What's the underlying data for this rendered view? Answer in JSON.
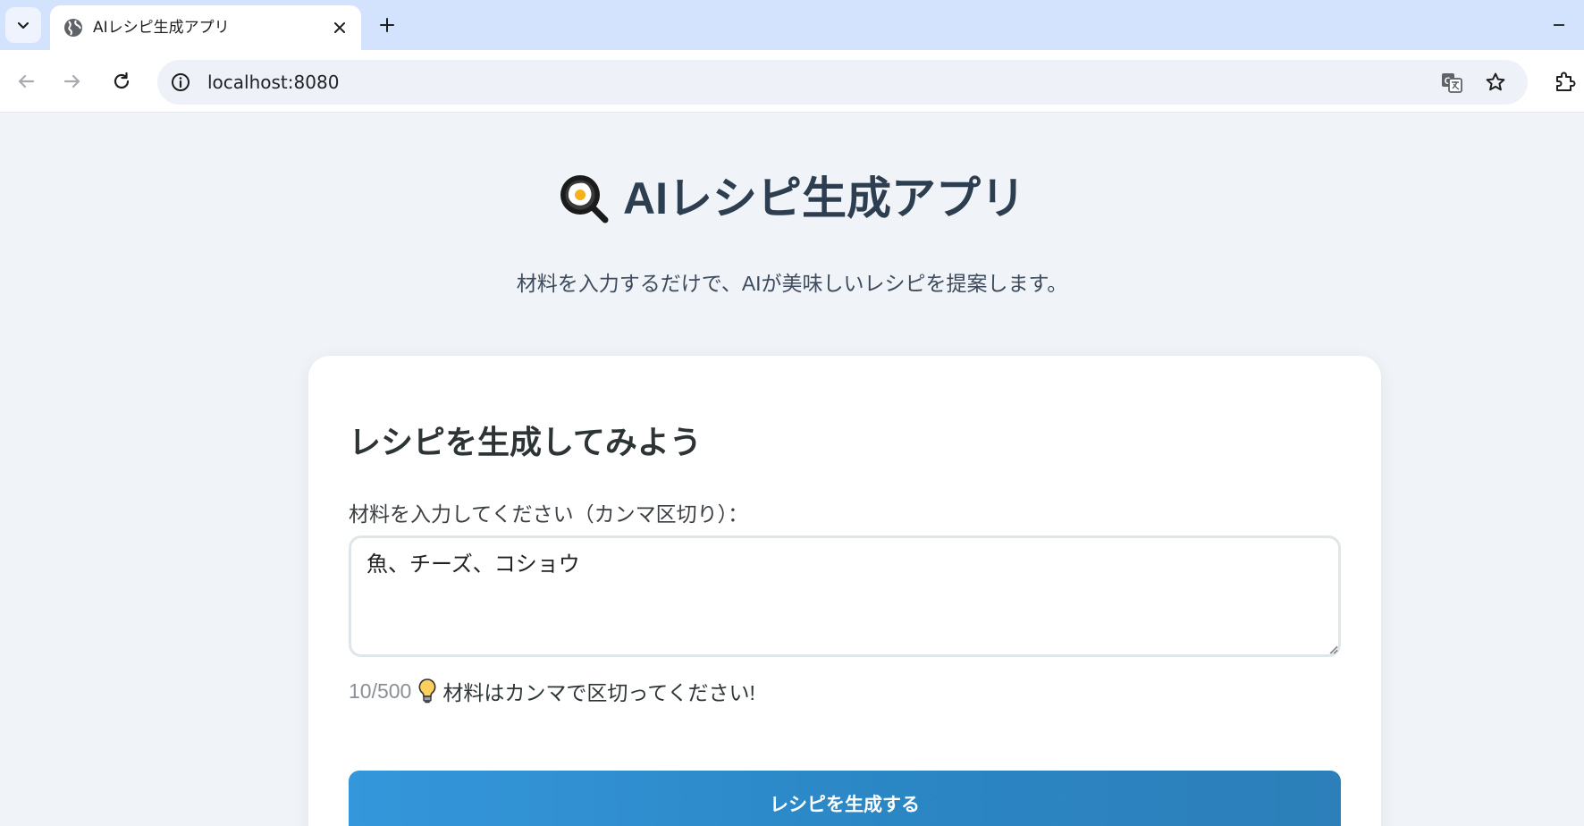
{
  "browser": {
    "tab_title": "AIレシピ生成アプリ",
    "url": "localhost:8080"
  },
  "page": {
    "title": "AIレシピ生成アプリ",
    "subtitle": "材料を入力するだけで、AIが美味しいレシピを提案します。"
  },
  "form": {
    "heading": "レシピを生成してみよう",
    "field_label": "材料を入力してください（カンマ区切り）：",
    "ingredients_value": "魚、チーズ、コショウ",
    "char_count": "10/500",
    "hint": "材料はカンマで区切ってください!",
    "submit_label": "レシピを生成する"
  },
  "colors": {
    "button": "#3497db",
    "title": "#2c3e50",
    "tabbar": "#d3e3fd"
  },
  "icons": {
    "title_icon": "frying-pan-egg-icon",
    "hint_icon": "light-bulb-icon"
  }
}
